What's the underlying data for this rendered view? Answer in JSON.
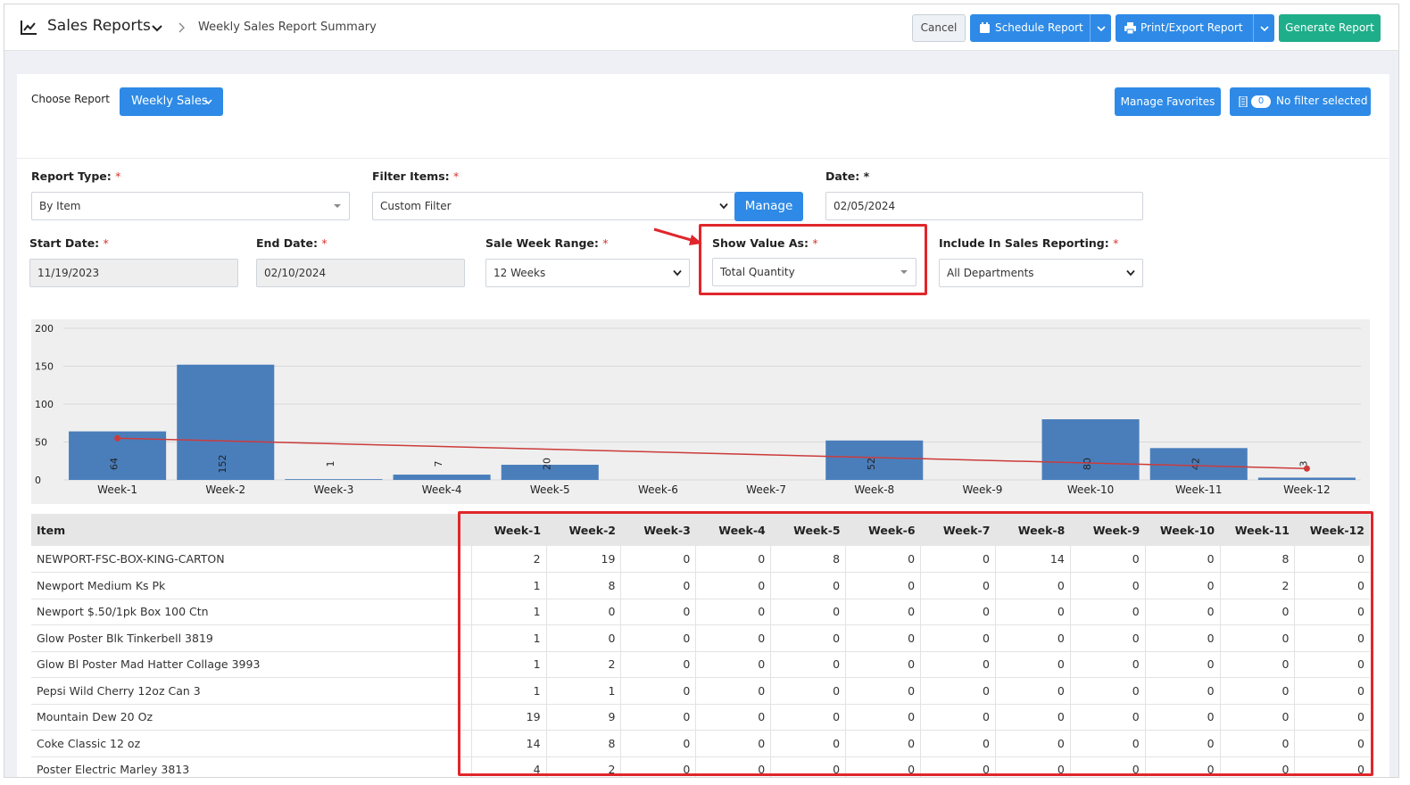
{
  "header": {
    "app_title": "Sales Reports",
    "breadcrumb": "Weekly Sales Report Summary",
    "cancel_label": "Cancel",
    "schedule_label": "Schedule Report",
    "print_label": "Print/Export Report",
    "generate_label": "Generate Report"
  },
  "toolbar": {
    "choose_report_label": "Choose Report",
    "report_button": "Weekly Sales",
    "manage_favorites": "Manage Favorites",
    "filter_count": "0",
    "filter_label": "No filter selected"
  },
  "form": {
    "report_type": {
      "label": "Report Type:",
      "value": "By Item"
    },
    "filter_items": {
      "label": "Filter Items:",
      "value": "Custom Filter",
      "manage": "Manage"
    },
    "date": {
      "label": "Date:",
      "value": "02/05/2024"
    },
    "start_date": {
      "label": "Start Date:",
      "value": "11/19/2023"
    },
    "end_date": {
      "label": "End Date:",
      "value": "02/10/2024"
    },
    "sale_week_range": {
      "label": "Sale Week Range:",
      "value": "12 Weeks"
    },
    "show_value_as": {
      "label": "Show Value As:",
      "value": "Total Quantity"
    },
    "include_in_sales": {
      "label": "Include In Sales Reporting:",
      "value": "All Departments"
    },
    "required_mark": "*"
  },
  "chart_data": {
    "type": "bar",
    "categories": [
      "Week-1",
      "Week-2",
      "Week-3",
      "Week-4",
      "Week-5",
      "Week-6",
      "Week-7",
      "Week-8",
      "Week-9",
      "Week-10",
      "Week-11",
      "Week-12"
    ],
    "values": [
      64,
      152,
      1,
      7,
      20,
      0,
      0,
      52,
      0,
      80,
      42,
      3
    ],
    "bar_labels": [
      "64",
      "152",
      "1",
      "7",
      "20",
      "",
      "",
      "52",
      "",
      "80",
      "42",
      "3"
    ],
    "trend": {
      "start": 55,
      "end": 15
    },
    "ylim": [
      0,
      200
    ],
    "yticks": [
      "0",
      "50",
      "100",
      "150",
      "200"
    ],
    "grid": true,
    "colors": {
      "bar": "#4a7ebb",
      "trend": "#cc3b3b"
    }
  },
  "table": {
    "item_header": "Item",
    "week_headers": [
      "Week-1",
      "Week-2",
      "Week-3",
      "Week-4",
      "Week-5",
      "Week-6",
      "Week-7",
      "Week-8",
      "Week-9",
      "Week-10",
      "Week-11",
      "Week-12"
    ],
    "rows": [
      {
        "item": "NEWPORT-FSC-BOX-KING-CARTON",
        "values": [
          "2",
          "19",
          "0",
          "0",
          "8",
          "0",
          "0",
          "14",
          "0",
          "0",
          "8",
          "0"
        ]
      },
      {
        "item": "Newport Medium Ks Pk",
        "values": [
          "1",
          "8",
          "0",
          "0",
          "0",
          "0",
          "0",
          "0",
          "0",
          "0",
          "2",
          "0"
        ]
      },
      {
        "item": "Newport $.50/1pk Box 100 Ctn",
        "values": [
          "1",
          "0",
          "0",
          "0",
          "0",
          "0",
          "0",
          "0",
          "0",
          "0",
          "0",
          "0"
        ]
      },
      {
        "item": "Glow Poster Blk Tinkerbell 3819",
        "values": [
          "1",
          "0",
          "0",
          "0",
          "0",
          "0",
          "0",
          "0",
          "0",
          "0",
          "0",
          "0"
        ]
      },
      {
        "item": "Glow Bl Poster Mad Hatter Collage 3993",
        "values": [
          "1",
          "2",
          "0",
          "0",
          "0",
          "0",
          "0",
          "0",
          "0",
          "0",
          "0",
          "0"
        ]
      },
      {
        "item": " Pepsi Wild Cherry 12oz Can    3",
        "values": [
          "1",
          "1",
          "0",
          "0",
          "0",
          "0",
          "0",
          "0",
          "0",
          "0",
          "0",
          "0"
        ]
      },
      {
        "item": "Mountain Dew 20 Oz",
        "values": [
          "19",
          "9",
          "0",
          "0",
          "0",
          "0",
          "0",
          "0",
          "0",
          "0",
          "0",
          "0"
        ]
      },
      {
        "item": "Coke Classic 12 oz",
        "values": [
          "14",
          "8",
          "0",
          "0",
          "0",
          "0",
          "0",
          "0",
          "0",
          "0",
          "0",
          "0"
        ]
      },
      {
        "item": "Poster Electric Marley 3813",
        "values": [
          "4",
          "2",
          "0",
          "0",
          "0",
          "0",
          "0",
          "0",
          "0",
          "0",
          "0",
          "0"
        ]
      }
    ]
  }
}
